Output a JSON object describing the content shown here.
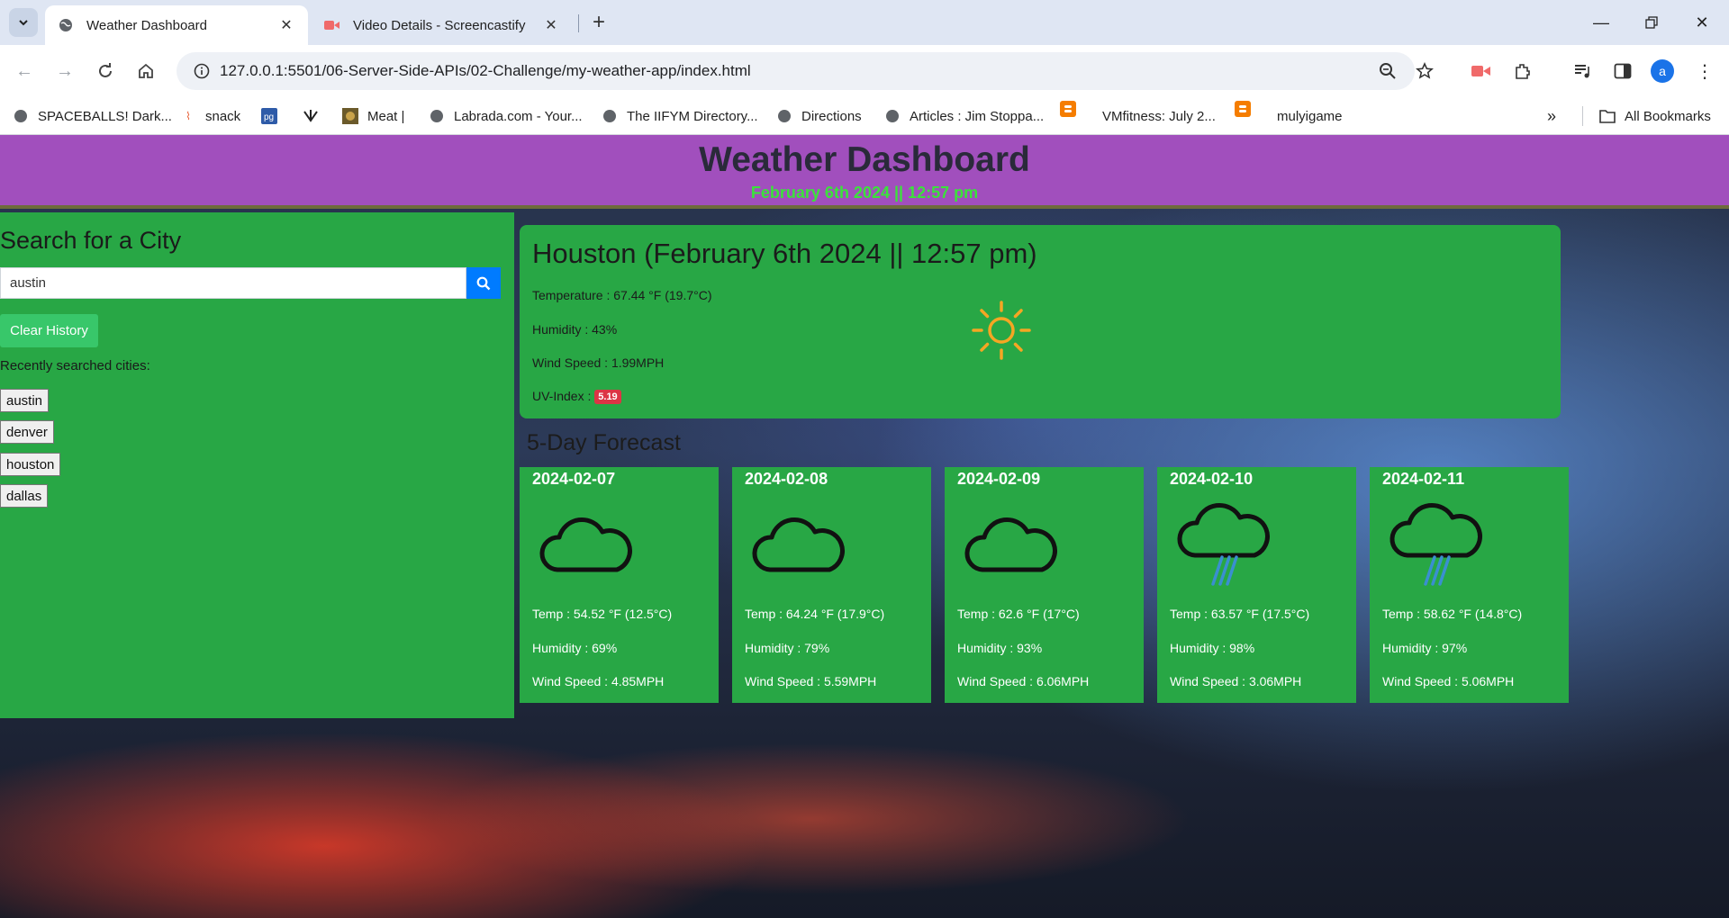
{
  "browser": {
    "tabs": [
      {
        "title": "Weather Dashboard",
        "active": true
      },
      {
        "title": "Video Details - Screencastify",
        "active": false
      }
    ],
    "url": "127.0.0.1:5501/06-Server-Side-APIs/02-Challenge/my-weather-app/index.html",
    "bookmarks": [
      "SPACEBALLS! Dark...",
      "snack",
      "",
      "",
      "Meat |",
      "Labrada.com - Your...",
      "The IIFYM Directory...",
      "Directions",
      "Articles : Jim Stoppa...",
      "VMfitness: July 2...",
      "mulyigame"
    ],
    "all_bookmarks": "All Bookmarks",
    "profile_initial": "a"
  },
  "header": {
    "title": "Weather Dashboard",
    "datetime": "February 6th 2024 || 12:57 pm"
  },
  "search": {
    "heading": "Search for a City",
    "value": "austin",
    "clear_label": "Clear History",
    "recent_label": "Recently searched cities:",
    "recent_cities": [
      "austin",
      "denver",
      "houston",
      "dallas"
    ]
  },
  "current": {
    "title": "Houston (February 6th 2024 || 12:57 pm)",
    "temperature": "Temperature : 67.44 °F (19.7°C)",
    "humidity": "Humidity : 43%",
    "wind": "Wind Speed : 1.99MPH",
    "uv_label": "UV-Index : ",
    "uv_value": "5.19",
    "icon": "sun-icon"
  },
  "forecast": {
    "title": "5-Day Forecast",
    "days": [
      {
        "date": "2024-02-07",
        "icon": "cloud-icon",
        "temp": "Temp : 54.52 °F (12.5°C)",
        "humidity": "Humidity : 69%",
        "wind": "Wind Speed : 4.85MPH"
      },
      {
        "date": "2024-02-08",
        "icon": "cloud-icon",
        "temp": "Temp : 64.24 °F (17.9°C)",
        "humidity": "Humidity : 79%",
        "wind": "Wind Speed : 5.59MPH"
      },
      {
        "date": "2024-02-09",
        "icon": "cloud-icon",
        "temp": "Temp : 62.6 °F (17°C)",
        "humidity": "Humidity : 93%",
        "wind": "Wind Speed : 6.06MPH"
      },
      {
        "date": "2024-02-10",
        "icon": "rain-cloud-icon",
        "temp": "Temp : 63.57 °F (17.5°C)",
        "humidity": "Humidity : 98%",
        "wind": "Wind Speed : 3.06MPH"
      },
      {
        "date": "2024-02-11",
        "icon": "rain-cloud-icon",
        "temp": "Temp : 58.62 °F (14.8°C)",
        "humidity": "Humidity : 97%",
        "wind": "Wind Speed : 5.06MPH"
      }
    ]
  },
  "colors": {
    "header_bg": "#a14fbd",
    "panel_green": "#28a745",
    "clock_green": "#3be23b",
    "search_blue": "#007bff",
    "uv_red": "#dc3545",
    "sun_orange": "#f5a623",
    "rain_blue": "#3a8fd0"
  }
}
